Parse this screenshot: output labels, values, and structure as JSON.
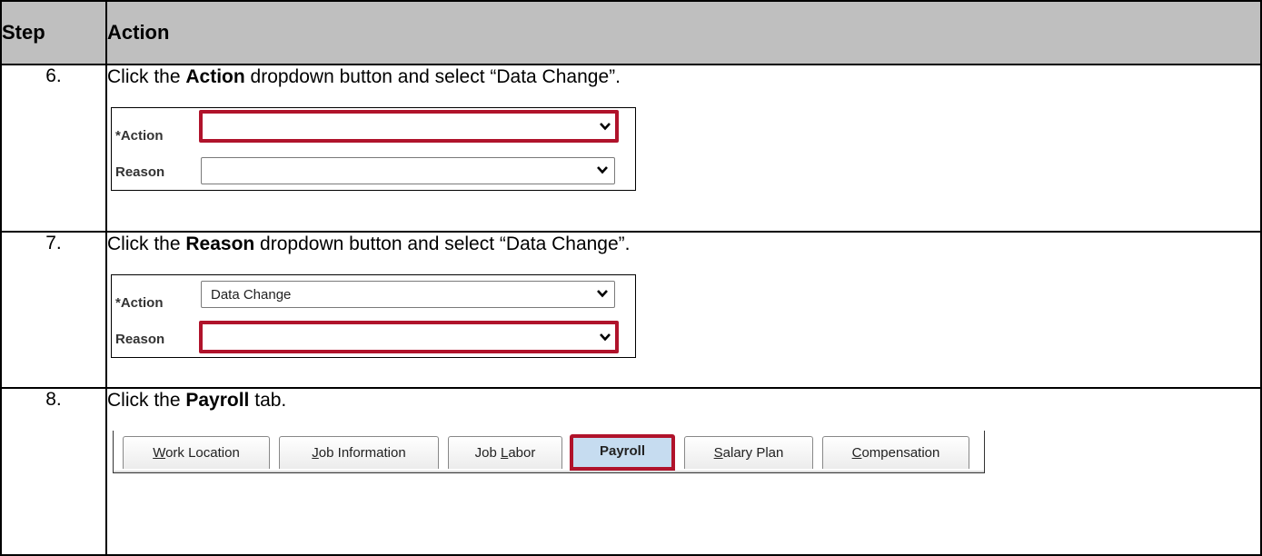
{
  "header": {
    "step": "Step",
    "action": "Action"
  },
  "steps": [
    {
      "num": "6.",
      "pre": "Click the ",
      "bold": "Action",
      "post": " dropdown button and select “Data Change”.",
      "form": {
        "action_label": "*Action",
        "action_value": "",
        "reason_label": "Reason",
        "reason_value": ""
      }
    },
    {
      "num": "7.",
      "pre": "Click the ",
      "bold": "Reason",
      "post": " dropdown button and select “Data Change”.",
      "form": {
        "action_label": "*Action",
        "action_value": "Data Change",
        "reason_label": "Reason",
        "reason_value": ""
      }
    },
    {
      "num": "8.",
      "pre": "Click the ",
      "bold": "Payroll",
      "post": " tab.",
      "tabs": [
        {
          "pre": "",
          "u": "W",
          "post": "ork Location"
        },
        {
          "pre": "",
          "u": "J",
          "post": "ob Information"
        },
        {
          "pre": "Job ",
          "u": "L",
          "post": "abor"
        },
        {
          "pre": "Payroll",
          "u": "",
          "post": ""
        },
        {
          "pre": "",
          "u": "S",
          "post": "alary Plan"
        },
        {
          "pre": "",
          "u": "C",
          "post": "ompensation"
        }
      ]
    }
  ],
  "icons": {
    "dropdown": "chevron-down-icon"
  },
  "colors": {
    "highlight": "#b0132b",
    "header_bg": "#bfbfbf",
    "active_tab": "#c6dcf0"
  }
}
